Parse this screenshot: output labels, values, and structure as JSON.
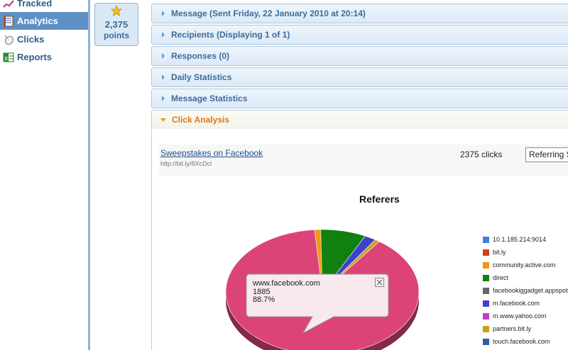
{
  "sidebar": {
    "items": [
      {
        "label": "Tracked",
        "icon": "tracked-chart-icon",
        "active": false
      },
      {
        "label": "Analytics",
        "icon": "notebook-icon",
        "active": true
      },
      {
        "label": "Clicks",
        "icon": "mouse-icon",
        "active": false
      },
      {
        "label": "Reports",
        "icon": "spreadsheet-icon",
        "active": false
      }
    ]
  },
  "points": {
    "value": "2,375",
    "label": "points",
    "icon": "star-icon"
  },
  "panels": [
    {
      "title": "Message (Sent Friday, 22 January 2010 at 20:14)"
    },
    {
      "title": "Recipients (Displaying 1 of 1)"
    },
    {
      "title": "Responses (0)"
    },
    {
      "title": "Daily Statistics"
    },
    {
      "title": "Message Statistics"
    },
    {
      "title": "Click Analysis"
    }
  ],
  "click_analysis": {
    "link_title": "Sweepstakes on Facebook",
    "link_url": "http://bit.ly/8XcDcl",
    "clicks": "2375 clicks",
    "select_value": "Referring Sites"
  },
  "tooltip": {
    "site": "www.facebook.com",
    "count": "1885",
    "percent": "88.7%"
  },
  "colors": {
    "accent": "#5d90c4",
    "open_panel_title": "#e27612",
    "panel_title": "#3a6d9c"
  },
  "chart_data": {
    "type": "pie",
    "title": "Referers",
    "legend_position": "right",
    "series": [
      {
        "name": "10.1.185.214:9014",
        "value": 0.0,
        "color": "#3f7fe0"
      },
      {
        "name": "bit.ly",
        "value": 0.0,
        "color": "#d0401a"
      },
      {
        "name": "community.active.com",
        "value": 1.0,
        "color": "#ef9a10"
      },
      {
        "name": "direct",
        "value": 7.6,
        "color": "#108010"
      },
      {
        "name": "facebookiggadget.appspot.com",
        "value": 0.0,
        "color": "#666666"
      },
      {
        "name": "m.facebook.com",
        "value": 1.9,
        "color": "#4040d0"
      },
      {
        "name": "m.www.yahoo.com",
        "value": 0.0,
        "color": "#c040c0"
      },
      {
        "name": "partners.bit.ly",
        "value": 0.8,
        "color": "#c8a010"
      },
      {
        "name": "touch.facebook.com",
        "value": 0.0,
        "color": "#2e5f9c"
      },
      {
        "name": "www.facebook.com",
        "value": 88.7,
        "color": "#dc4478"
      }
    ]
  }
}
